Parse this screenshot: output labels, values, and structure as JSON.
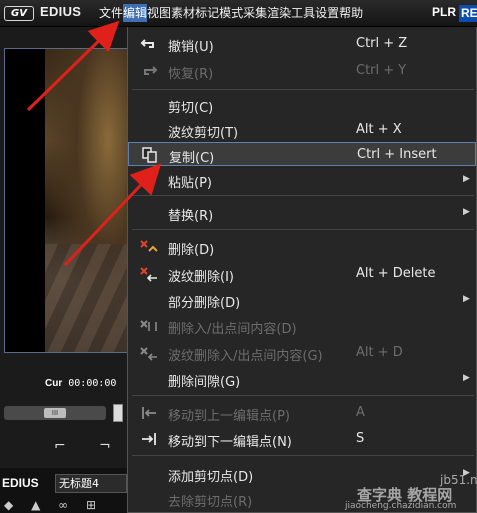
{
  "app": {
    "logo_text": "GV",
    "brand": "EDIUS",
    "plr": "PLR",
    "plr_suffix": "RE"
  },
  "menubar": [
    {
      "label": "文件"
    },
    {
      "label": "编辑"
    },
    {
      "label": "视图"
    },
    {
      "label": "素材"
    },
    {
      "label": "标记"
    },
    {
      "label": "模式"
    },
    {
      "label": "采集"
    },
    {
      "label": "渲染"
    },
    {
      "label": "工具"
    },
    {
      "label": "设置"
    },
    {
      "label": "帮助"
    }
  ],
  "preview": {
    "cur_label": "Cur",
    "timecode": "00:00:00",
    "scrub_knob": "III"
  },
  "timeline": {
    "brand": "EDIUS",
    "project": "无标题4"
  },
  "menu": {
    "items": [
      {
        "label": "撤销(U)",
        "shortcut": "Ctrl + Z",
        "icon": "undo-icon"
      },
      {
        "label": "恢复(R)",
        "shortcut": "Ctrl + Y",
        "icon": "redo-icon"
      },
      {
        "label": "剪切(C)",
        "shortcut": ""
      },
      {
        "label": "波纹剪切(T)",
        "shortcut": "Alt + X"
      },
      {
        "label": "复制(C)",
        "shortcut": "Ctrl + Insert",
        "icon": "copy-icon"
      },
      {
        "label": "粘贴(P)",
        "shortcut": ""
      },
      {
        "label": "替换(R)",
        "shortcut": ""
      },
      {
        "label": "删除(D)",
        "shortcut": "",
        "icon": "delete-icon"
      },
      {
        "label": "波纹删除(I)",
        "shortcut": "Alt + Delete",
        "icon": "ripple-delete-icon"
      },
      {
        "label": "部分删除(D)",
        "shortcut": ""
      },
      {
        "label": "删除入/出点间内容(D)",
        "shortcut": "",
        "icon": "delete-in-out-icon"
      },
      {
        "label": "波纹删除入/出点间内容(G)",
        "shortcut": "Alt + D",
        "icon": "ripple-delete-in-out-icon"
      },
      {
        "label": "删除间隙(G)",
        "shortcut": ""
      },
      {
        "label": "移动到上一编辑点(P)",
        "shortcut": "A",
        "icon": "prev-edit-point-icon"
      },
      {
        "label": "移动到下一编辑点(N)",
        "shortcut": "S",
        "icon": "next-edit-point-icon"
      },
      {
        "label": "添加剪切点(D)",
        "shortcut": ""
      },
      {
        "label": "去除剪切点(R)",
        "shortcut": ""
      }
    ]
  },
  "watermark": {
    "site": "jb51.net",
    "cn": "查字典 教程网",
    "url": "jiaocheng.chazidian.com"
  },
  "colors": {
    "menu_bg": "#262626",
    "highlight_border": "#5e7fb1",
    "active_menu": "#3f6fb0",
    "arrow_red": "#e0211b",
    "disabled_text": "#6d6d6d"
  }
}
